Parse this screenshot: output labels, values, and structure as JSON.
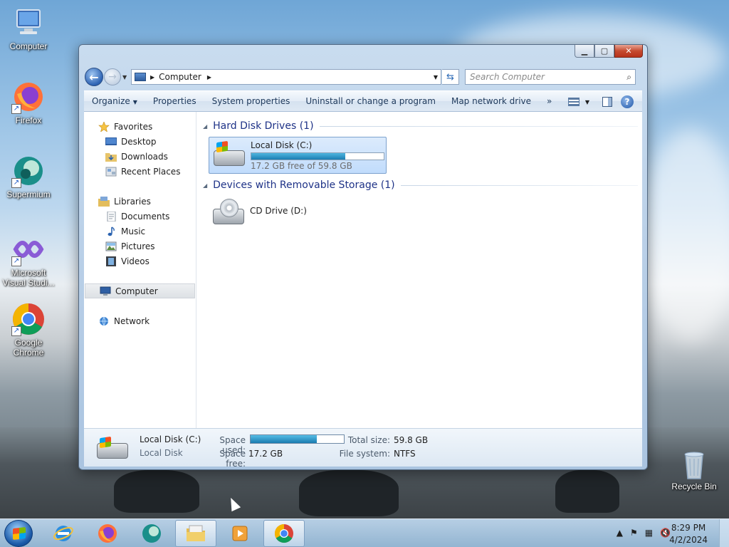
{
  "desktop": {
    "icons": [
      {
        "label": "Computer"
      },
      {
        "label": "Firefox"
      },
      {
        "label": "Supermium"
      },
      {
        "label": "Microsoft Visual Studi..."
      },
      {
        "label": "Google Chrome"
      },
      {
        "label": "Recycle Bin"
      }
    ]
  },
  "window": {
    "address": {
      "crumb": "Computer",
      "search_placeholder": "Search Computer"
    },
    "command_bar": {
      "organize": "Organize",
      "properties": "Properties",
      "system_properties": "System properties",
      "uninstall": "Uninstall or change a program",
      "map_network": "Map network drive",
      "more": "»"
    },
    "nav_pane": {
      "favorites": "Favorites",
      "desktop": "Desktop",
      "downloads": "Downloads",
      "recent_places": "Recent Places",
      "libraries": "Libraries",
      "documents": "Documents",
      "music": "Music",
      "pictures": "Pictures",
      "videos": "Videos",
      "computer": "Computer",
      "network": "Network"
    },
    "groups": {
      "hard_disk": "Hard Disk Drives (1)",
      "removable": "Devices with Removable Storage (1)"
    },
    "drives": {
      "local": {
        "name": "Local Disk (C:)",
        "free_text": "17.2 GB free of 59.8 GB",
        "used_fraction": 0.712
      },
      "cd": {
        "name": "CD Drive (D:)"
      }
    },
    "details": {
      "name": "Local Disk (C:)",
      "type": "Local Disk",
      "space_used_label": "Space used:",
      "space_free_label": "Space free:",
      "space_free": "17.2 GB",
      "total_size_label": "Total size:",
      "total_size": "59.8 GB",
      "file_system_label": "File system:",
      "file_system": "NTFS"
    }
  },
  "taskbar": {
    "time": "8:29 PM",
    "date": "4/2/2024"
  },
  "colors": {
    "accent": "#1e3287",
    "bar_fill": "#1c7db2"
  }
}
